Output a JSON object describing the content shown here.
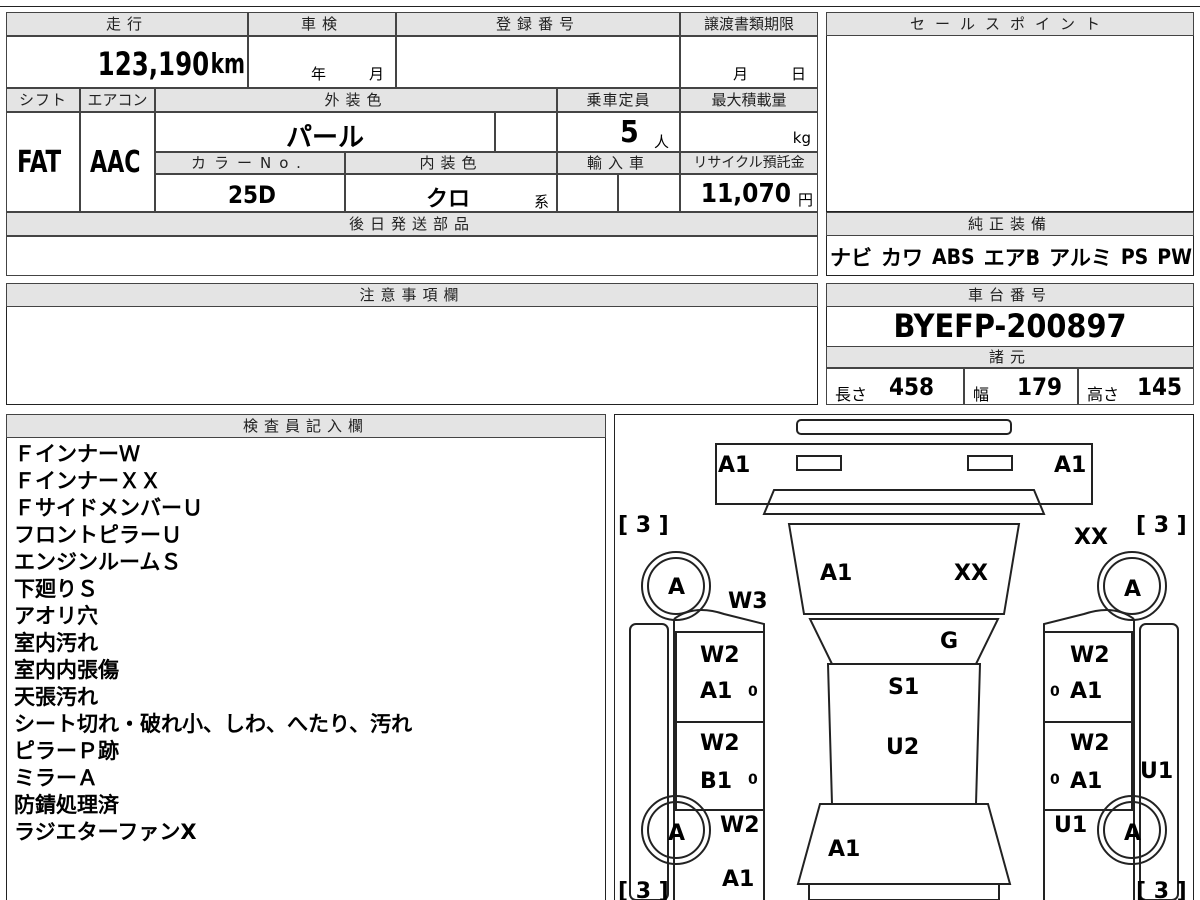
{
  "mileage": {
    "label": "走行",
    "value": "123,190",
    "unit": "km"
  },
  "shaken": {
    "label": "車検",
    "year_unit": "年",
    "month_unit": "月"
  },
  "registration": {
    "label": "登録番号"
  },
  "transfer": {
    "label": "譲渡書類期限",
    "month_unit": "月",
    "day_unit": "日"
  },
  "shift": {
    "label": "シフト",
    "value": "FAT"
  },
  "aircon": {
    "label": "エアコン",
    "value": "AAC"
  },
  "exterior": {
    "label": "外装色",
    "value": "パール"
  },
  "capacity": {
    "label": "乗車定員",
    "value": "5",
    "unit": "人"
  },
  "max_load": {
    "label": "最大積載量",
    "unit": "kg"
  },
  "color_no": {
    "label": "カラーNo.",
    "value": "25D"
  },
  "interior": {
    "label": "内装色",
    "value": "クロ",
    "suffix": "系"
  },
  "import": {
    "label": "輸入車"
  },
  "recycle": {
    "label": "リサイクル預託金",
    "value": "11,070",
    "unit": "円"
  },
  "later_parts": {
    "label": "後日発送部品"
  },
  "sale_points": {
    "label": "セールスポイント"
  },
  "genuine": {
    "label": "純正装備",
    "items": [
      "ナビ",
      "カワ",
      "ABS",
      "エアB",
      "アルミ",
      "PS",
      "PW"
    ]
  },
  "caution": {
    "label": "注意事項欄"
  },
  "chassis": {
    "label": "車台番号",
    "value": "BYEFP-200897"
  },
  "specs": {
    "label": "諸元",
    "length_label": "長さ",
    "length": "458",
    "width_label": "幅",
    "width": "179",
    "height_label": "高さ",
    "height": "145"
  },
  "inspector": {
    "label": "検査員記入欄",
    "notes": [
      "ＦインナーＷ",
      "ＦインナーＸＸ",
      "ＦサイドメンバーＵ",
      "フロントピラーＵ",
      "エンジンルームＳ",
      "下廻りＳ",
      "アオリ穴",
      "室内汚れ",
      "室内内張傷",
      "天張汚れ",
      "シート切れ・破れ小、しわ、へたり、汚れ",
      "ピラーＰ跡",
      "ミラーＡ",
      "防錆処理済",
      "ラジエターファンX"
    ]
  },
  "diagram": {
    "bracket": "[ 3 ]",
    "tire": "A",
    "codes": {
      "front_left": "A1",
      "front_right": "A1",
      "hood_left": "A1",
      "hood_right": "XX",
      "fender_right_top": "XX",
      "fender_left": "W3",
      "cowl": "G",
      "roof_front": "S1",
      "roof_rear": "U2",
      "fl_door_top": "W2",
      "fl_door_bot": "A1",
      "rl_door_top": "W2",
      "rl_door_bot": "B1",
      "fr_door_top": "W2",
      "fr_door_bot": "A1",
      "rr_door_top": "W2",
      "rr_door_bot": "A1",
      "rear_quarter_left": "W2",
      "rear_quarter_right": "U1",
      "side_right": "U1",
      "trunk": "A1",
      "rear_bumper": "A1",
      "zero": "0"
    }
  }
}
